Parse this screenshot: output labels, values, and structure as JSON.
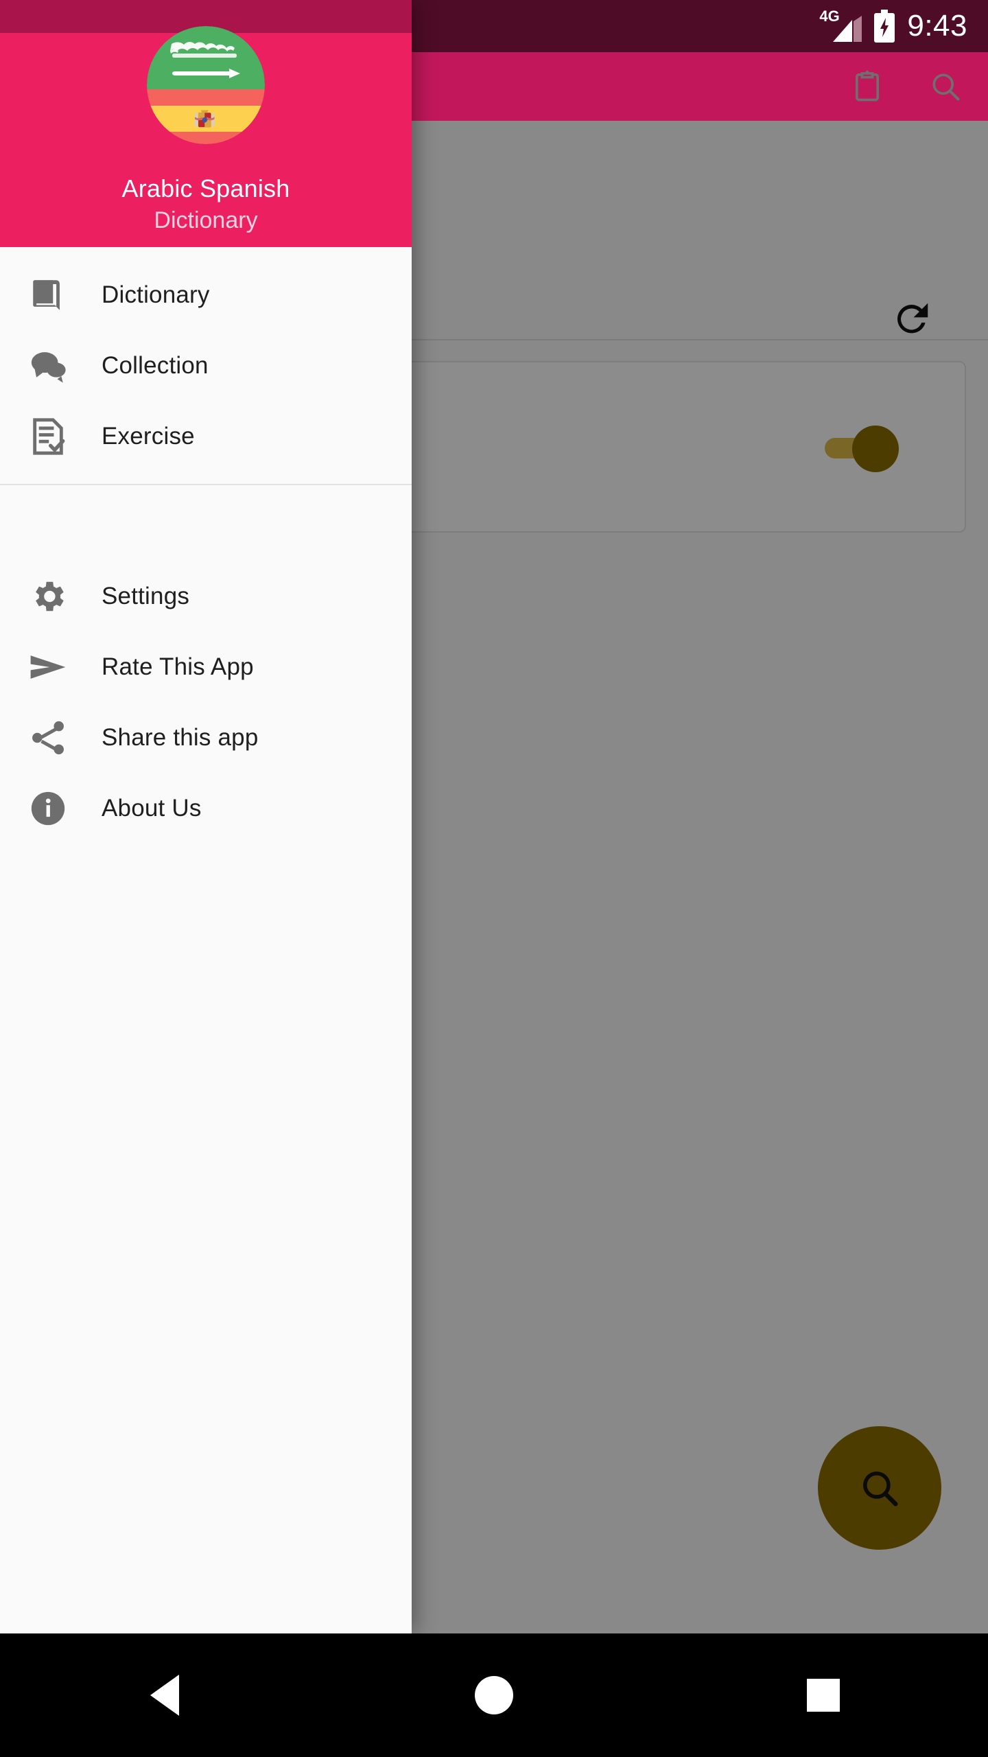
{
  "status_bar": {
    "network_label": "4G",
    "signal_icon": "signal-bars-icon",
    "battery_icon": "battery-charging-icon",
    "time": "9:43"
  },
  "app_bar": {
    "background_color": "#c2185b",
    "actions": [
      {
        "name": "clipboard-icon",
        "label": "Clipboard"
      },
      {
        "name": "search-icon",
        "label": "Search"
      }
    ]
  },
  "content": {
    "refresh_icon": "refresh-icon",
    "switch_state": "on",
    "fab": {
      "icon": "search-icon",
      "color": "#8a6d00"
    }
  },
  "drawer": {
    "header": {
      "background_color": "#ec1f61",
      "avatar_icon": "arabic-spanish-flags-avatar",
      "title": "Arabic  Spanish",
      "subtitle": "Dictionary"
    },
    "primary_items": [
      {
        "icon": "book-icon",
        "label": "Dictionary"
      },
      {
        "icon": "chat-bubbles-icon",
        "label": "Collection"
      },
      {
        "icon": "exercise-checklist-icon",
        "label": "Exercise"
      }
    ],
    "secondary_items": [
      {
        "icon": "gear-icon",
        "label": "Settings"
      },
      {
        "icon": "send-icon",
        "label": "Rate This App"
      },
      {
        "icon": "share-icon",
        "label": "Share this app"
      },
      {
        "icon": "info-icon",
        "label": "About Us"
      }
    ]
  },
  "nav_bar": {
    "buttons": [
      {
        "name": "back-button",
        "label": "Back"
      },
      {
        "name": "home-button",
        "label": "Home"
      },
      {
        "name": "recents-button",
        "label": "Recents"
      }
    ]
  }
}
